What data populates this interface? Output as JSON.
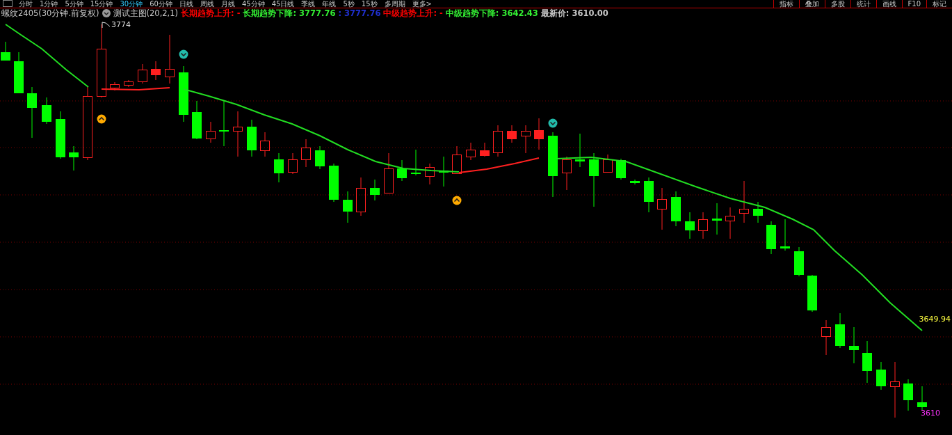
{
  "toolbar": {
    "periods": [
      {
        "label": "分时",
        "selected": false
      },
      {
        "label": "1分钟",
        "selected": false
      },
      {
        "label": "5分钟",
        "selected": false
      },
      {
        "label": "15分钟",
        "selected": false
      },
      {
        "label": "30分钟",
        "selected": true
      },
      {
        "label": "60分钟",
        "selected": false
      },
      {
        "label": "日线",
        "selected": false
      },
      {
        "label": "周线",
        "selected": false
      },
      {
        "label": "月线",
        "selected": false
      },
      {
        "label": "45分钟",
        "selected": false
      },
      {
        "label": "45日线",
        "selected": false
      },
      {
        "label": "季线",
        "selected": false
      },
      {
        "label": "年线",
        "selected": false
      },
      {
        "label": "5秒",
        "selected": false
      },
      {
        "label": "15秒",
        "selected": false
      },
      {
        "label": "多周期",
        "selected": false
      },
      {
        "label": "更多>",
        "selected": false
      }
    ],
    "tools": [
      "指标",
      "叠加",
      "多股",
      "统计",
      "画线",
      "F10",
      "标记"
    ]
  },
  "info_line": {
    "symbol": "螺纹2405(30分钟.前复权)",
    "indicator": "测试主图(20,2,1)",
    "values": [
      {
        "text": "长期趋势上升: -",
        "color": "#ff0000"
      },
      {
        "text": "长期趋势下降: 3777.76",
        "color": "#33ee33"
      },
      {
        "text": ": 3777.76",
        "color": "#2030d0"
      },
      {
        "text": "中级趋势上升: -",
        "color": "#ff0000"
      },
      {
        "text": "中级趋势下降: 3642.43",
        "color": "#33ee33"
      },
      {
        "text": "最新价: 3610.00",
        "color": "#c8c8c8"
      }
    ]
  },
  "chart": {
    "high_label": "3774",
    "ma_label": "3649.94",
    "last_label": "3610"
  }
}
